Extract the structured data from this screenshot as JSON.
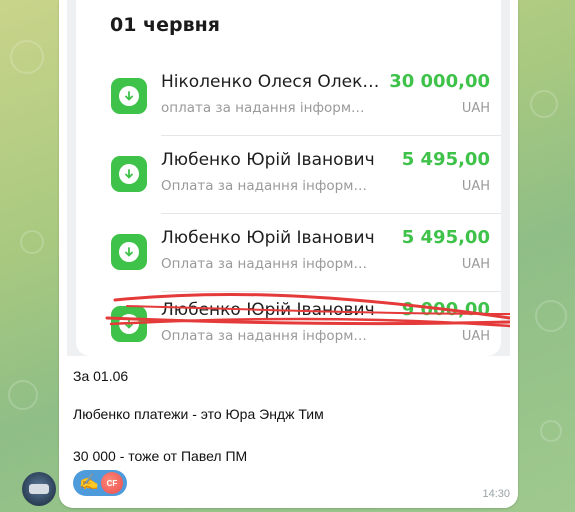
{
  "statement": {
    "date": "01 червня",
    "transactions": [
      {
        "name": "Ніколенко Олеся Олек…",
        "description": "оплата за надання інформ…",
        "amount": "30 000,00",
        "currency": "UAH",
        "struck": false
      },
      {
        "name": "Любенко Юрій Іванович",
        "description": "Оплата за надання інформаці…",
        "amount": "5 495,00",
        "currency": "UAH",
        "struck": false
      },
      {
        "name": "Любенко Юрій Іванович",
        "description": "Оплата за надання інформаці…",
        "amount": "5 495,00",
        "currency": "UAH",
        "struck": false
      },
      {
        "name": "Любенко Юрій Іванович",
        "description": "Оплата за надання інформ…",
        "amount": "9 000,00",
        "currency": "UAH",
        "struck": true
      }
    ],
    "accent_color": "#3fc24a",
    "strike_color": "#e53a3a"
  },
  "message": {
    "lines": [
      "За 01.06",
      "Любенко платежи - это Юра Эндж Тим",
      "30 000 - тоже от Павел ПМ"
    ],
    "time": "14:30",
    "reaction": {
      "emoji": "✍️",
      "avatar_initials": "CF"
    }
  }
}
